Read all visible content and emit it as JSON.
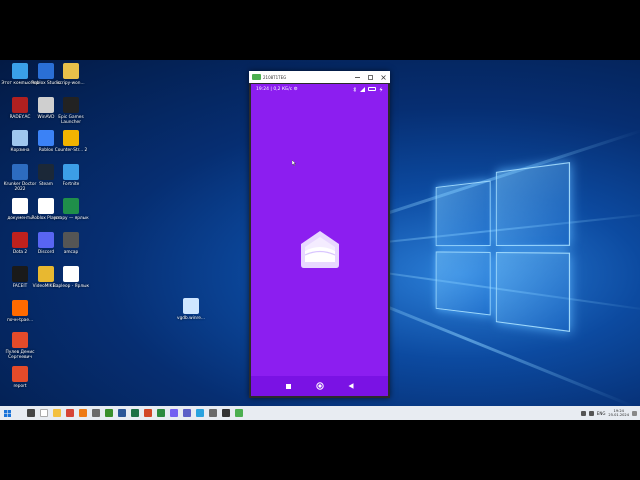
{
  "desktop": {
    "icons": [
      {
        "label": "Этот компьютер",
        "icon": "computer-icon",
        "color": "#3aa0e8"
      },
      {
        "label": "Roblox Studio",
        "icon": "roblox-studio-icon",
        "color": "#2a6fd6"
      },
      {
        "label": "scripy-won...",
        "icon": "folder-icon",
        "color": "#e8c04a"
      },
      {
        "label": "RADEY.AC",
        "icon": "radey-icon",
        "color": "#b02020"
      },
      {
        "label": "WinAVD",
        "icon": "disc-icon",
        "color": "#cfcfcf"
      },
      {
        "label": "Epic Games Launcher",
        "icon": "epic-games-icon",
        "color": "#222222"
      },
      {
        "label": "Корзина",
        "icon": "recycle-bin-icon",
        "color": "#9fc7ee"
      },
      {
        "label": "Roblox",
        "icon": "roblox-icon",
        "color": "#3b82f6"
      },
      {
        "label": "Counter-Str... 2",
        "icon": "cs2-icon",
        "color": "#f2b400"
      },
      {
        "label": "Krunker Doctor 2022",
        "icon": "krunker-icon",
        "color": "#2d6cc0"
      },
      {
        "label": "Steam",
        "icon": "steam-icon",
        "color": "#1b2838"
      },
      {
        "label": "Fortnite",
        "icon": "fortnite-icon",
        "color": "#3c9ee6"
      },
      {
        "label": "документы",
        "icon": "document-icon",
        "color": "#ffffff"
      },
      {
        "label": "Roblox Player",
        "icon": "roblox-player-icon",
        "color": "#ffffff"
      },
      {
        "label": "scrapy — ярлык",
        "icon": "script-icon",
        "color": "#1f8f4a"
      },
      {
        "label": "Dota 2",
        "icon": "dota2-icon",
        "color": "#c0211d"
      },
      {
        "label": "Discord",
        "icon": "discord-icon",
        "color": "#5865f2"
      },
      {
        "label": "amcap",
        "icon": "amcap-icon",
        "color": "#555555"
      },
      {
        "label": "FACEIT",
        "icon": "faceit-icon",
        "color": "#1a1a1a"
      },
      {
        "label": "VideoMIKE...",
        "icon": "video-icon",
        "color": "#e8b830"
      },
      {
        "label": "Bapleop - Ярлык",
        "icon": "file-icon",
        "color": "#ffffff"
      },
      {
        "label": "почн-tpae...",
        "icon": "faceit-alt-icon",
        "color": "#ff6a00"
      },
      {
        "label": "vgdb.winre...",
        "icon": "image-file-icon",
        "color": "#cfe6ff"
      },
      {
        "label": "Пулев Денис Сергеевич",
        "icon": "pdf-icon",
        "color": "#e44b2a"
      },
      {
        "label": "report",
        "icon": "report-icon",
        "color": "#e44b2a"
      }
    ]
  },
  "phone_window": {
    "title": "2108T1TEG",
    "status": {
      "time": "19:24 | 0,2 КБ/с ⚙"
    }
  },
  "taskbar": {
    "apps": [
      {
        "name": "search-icon",
        "color": "#444444"
      },
      {
        "name": "yandex-icon",
        "color": "#ffffff"
      },
      {
        "name": "explorer-icon",
        "color": "#f3c03f"
      },
      {
        "name": "chrome-icon",
        "color": "#d64436"
      },
      {
        "name": "vlc-icon",
        "color": "#ee7a14"
      },
      {
        "name": "word-icon",
        "color": "#6b6b6b"
      },
      {
        "name": "minecraft-icon",
        "color": "#3a8f2b"
      },
      {
        "name": "word2-icon",
        "color": "#2b5797"
      },
      {
        "name": "excel-icon",
        "color": "#1e7145"
      },
      {
        "name": "powerpoint-icon",
        "color": "#d24726"
      },
      {
        "name": "photos-icon",
        "color": "#2b8a3e"
      },
      {
        "name": "viber-icon",
        "color": "#7360f2"
      },
      {
        "name": "teams-icon",
        "color": "#5b5fc7"
      },
      {
        "name": "telegram-icon",
        "color": "#2aa3df"
      },
      {
        "name": "settings-icon",
        "color": "#6a6a6a"
      },
      {
        "name": "terminal-icon",
        "color": "#333333"
      },
      {
        "name": "emulator-icon",
        "color": "#4caf50"
      }
    ],
    "tray": {
      "lang": "ENG",
      "time": "19:24",
      "date": "25.01.2024"
    }
  }
}
